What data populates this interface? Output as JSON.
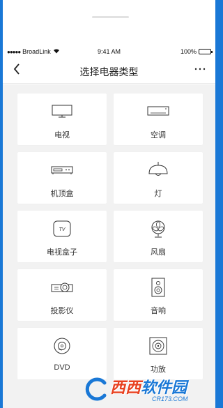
{
  "status_bar": {
    "carrier": "BroadLink",
    "signal_dots": "●●●●●",
    "time": "9:41 AM",
    "battery": "100%"
  },
  "nav": {
    "back_icon": "chevron-left-icon",
    "title": "选择电器类型",
    "more_icon": "more-horizontal-icon"
  },
  "devices": [
    {
      "label": "电视",
      "icon": "tv-icon"
    },
    {
      "label": "空调",
      "icon": "air-conditioner-icon"
    },
    {
      "label": "机顶盒",
      "icon": "set-top-box-icon"
    },
    {
      "label": "灯",
      "icon": "lamp-icon"
    },
    {
      "label": "电视盒子",
      "icon": "tv-box-icon"
    },
    {
      "label": "风扇",
      "icon": "fan-icon"
    },
    {
      "label": "投影仪",
      "icon": "projector-icon"
    },
    {
      "label": "音响",
      "icon": "speaker-icon"
    },
    {
      "label": "DVD",
      "icon": "dvd-icon"
    },
    {
      "label": "功放",
      "icon": "amplifier-icon"
    }
  ],
  "tv_box_icon_text": "TV",
  "watermark": {
    "main_red": "西西",
    "main_blue": "软件园",
    "sub": "CR173.COM"
  },
  "colors": {
    "brand_blue": "#1a78d6",
    "background_gray": "#f2f2f2"
  }
}
